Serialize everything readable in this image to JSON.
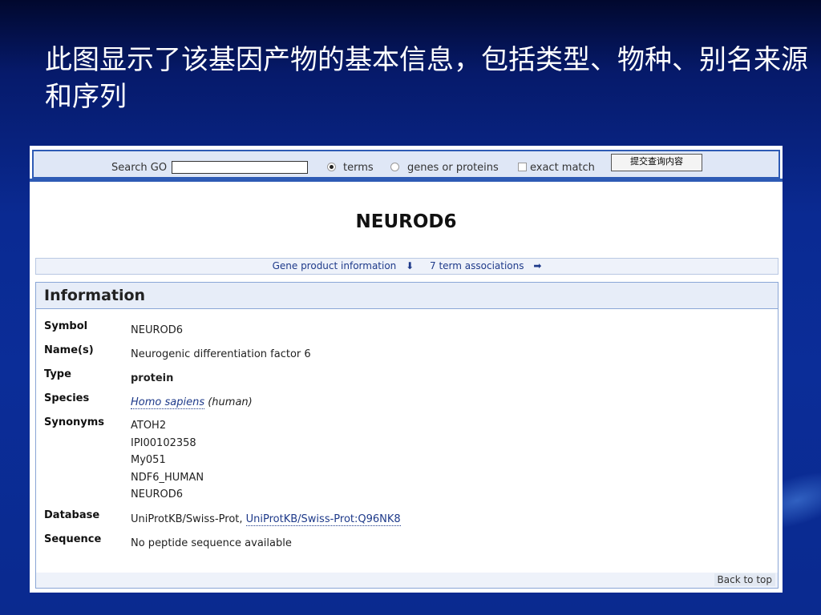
{
  "slide": {
    "title": "此图显示了该基因产物的基本信息，包括类型、物种、别名来源和序列"
  },
  "search": {
    "label": "Search GO",
    "input_value": "",
    "options": [
      {
        "label": "terms",
        "checked": true
      },
      {
        "label": "genes or proteins",
        "checked": false
      }
    ],
    "exact_match_label": "exact match",
    "submit_label": "提交查询内容"
  },
  "gene": {
    "title": "NEUROD6"
  },
  "nav": {
    "info_link": "Gene product information",
    "assoc_link": "7 term associations"
  },
  "info": {
    "heading": "Information",
    "symbol_label": "Symbol",
    "symbol": "NEUROD6",
    "names_label": "Name(s)",
    "names": "Neurogenic differentiation factor 6",
    "type_label": "Type",
    "type": "protein",
    "species_label": "Species",
    "species_link": "Homo sapiens",
    "species_common": "(human)",
    "synonyms_label": "Synonyms",
    "synonyms": [
      "ATOH2",
      "IPI00102358",
      "My051",
      "NDF6_HUMAN",
      "NEUROD6"
    ],
    "database_label": "Database",
    "database_text": "UniProtKB/Swiss-Prot,",
    "database_link": "UniProtKB/Swiss-Prot:Q96NK8",
    "sequence_label": "Sequence",
    "sequence": "No peptide sequence available"
  },
  "footer": {
    "back_to_top": "Back to top"
  },
  "colors": {
    "slide_bg": "#0a2a92",
    "accent_blue": "#2e5bb5",
    "link": "#1e3a8a"
  }
}
